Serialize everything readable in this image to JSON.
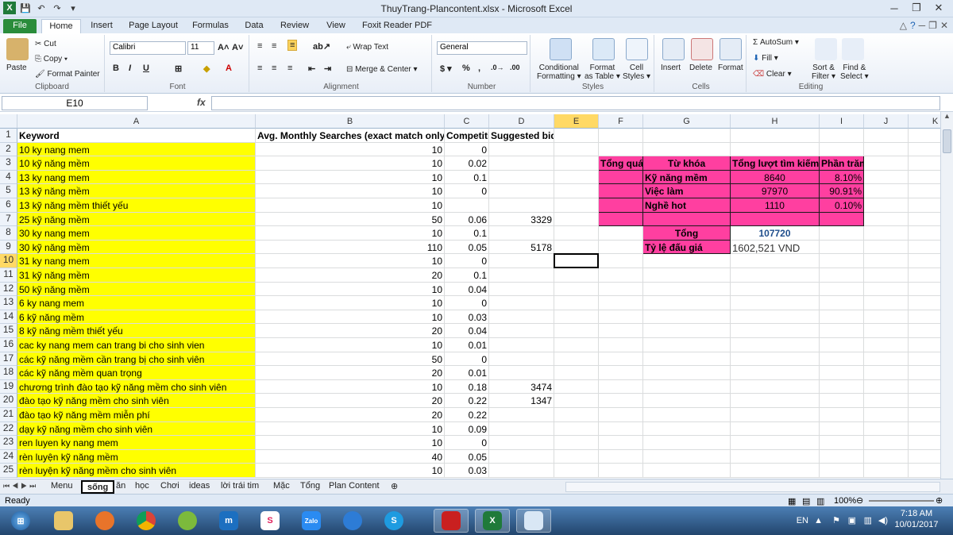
{
  "window": {
    "title": "ThuyTrang-Plancontent.xlsx - Microsoft Excel"
  },
  "ribbon": {
    "tabs": [
      "File",
      "Home",
      "Insert",
      "Page Layout",
      "Formulas",
      "Data",
      "Review",
      "View",
      "Foxit Reader PDF"
    ],
    "clipboard": {
      "paste": "Paste",
      "cut": "Cut",
      "copy": "Copy",
      "format_painter": "Format Painter",
      "label": "Clipboard"
    },
    "font": {
      "name": "Calibri",
      "size": "11",
      "label": "Font"
    },
    "alignment": {
      "wrap": "Wrap Text",
      "merge": "Merge & Center",
      "label": "Alignment"
    },
    "number": {
      "format": "General",
      "label": "Number"
    },
    "styles": {
      "conditional": "Conditional\nFormatting",
      "format_table": "Format\nas Table",
      "cell_styles": "Cell\nStyles",
      "label": "Styles"
    },
    "cells": {
      "insert": "Insert",
      "delete": "Delete",
      "format": "Format",
      "label": "Cells"
    },
    "editing": {
      "autosum": "AutoSum",
      "fill": "Fill",
      "clear": "Clear",
      "sort": "Sort &\nFilter",
      "find": "Find &\nSelect",
      "label": "Editing"
    }
  },
  "formula_bar": {
    "name_box": "E10",
    "fx": "fx",
    "content": ""
  },
  "columns": [
    "A",
    "B",
    "C",
    "D",
    "E",
    "F",
    "G",
    "H",
    "I",
    "J",
    "K"
  ],
  "selected_cell": "E10",
  "rows": [
    {
      "n": "1",
      "a": "Keyword",
      "b": "Avg. Monthly Searches (exact match only)",
      "c": "Competiti",
      "d": "Suggested bid"
    },
    {
      "n": "2",
      "a": "10 ky nang mem",
      "b": "10",
      "c": "0",
      "d": ""
    },
    {
      "n": "3",
      "a": "10 kỹ năng mềm",
      "b": "10",
      "c": "0.02",
      "d": ""
    },
    {
      "n": "4",
      "a": "13 ky nang mem",
      "b": "10",
      "c": "0.1",
      "d": ""
    },
    {
      "n": "5",
      "a": "13 kỹ năng mềm",
      "b": "10",
      "c": "0",
      "d": ""
    },
    {
      "n": "6",
      "a": "13 kỹ năng mềm thiết yếu",
      "b": "10",
      "c": "",
      "d": ""
    },
    {
      "n": "7",
      "a": "25 kỹ năng mềm",
      "b": "50",
      "c": "0.06",
      "d": "3329"
    },
    {
      "n": "8",
      "a": "30 ky nang mem",
      "b": "10",
      "c": "0.1",
      "d": ""
    },
    {
      "n": "9",
      "a": "30 kỹ năng mềm",
      "b": "110",
      "c": "0.05",
      "d": "5178"
    },
    {
      "n": "10",
      "a": "31 ky nang mem",
      "b": "10",
      "c": "0",
      "d": ""
    },
    {
      "n": "11",
      "a": "31 kỹ năng mềm",
      "b": "20",
      "c": "0.1",
      "d": ""
    },
    {
      "n": "12",
      "a": "50 kỹ năng mềm",
      "b": "10",
      "c": "0.04",
      "d": ""
    },
    {
      "n": "13",
      "a": "6 ky nang mem",
      "b": "10",
      "c": "0",
      "d": ""
    },
    {
      "n": "14",
      "a": "6 kỹ năng mềm",
      "b": "10",
      "c": "0.03",
      "d": ""
    },
    {
      "n": "15",
      "a": "8 kỹ năng mềm thiết yếu",
      "b": "20",
      "c": "0.04",
      "d": ""
    },
    {
      "n": "16",
      "a": "cac ky nang mem can trang bi cho sinh vien",
      "b": "10",
      "c": "0.01",
      "d": ""
    },
    {
      "n": "17",
      "a": "các kỹ năng mềm cần trang bị cho sinh viên",
      "b": "50",
      "c": "0",
      "d": ""
    },
    {
      "n": "18",
      "a": "các kỹ năng mềm quan trọng",
      "b": "20",
      "c": "0.01",
      "d": ""
    },
    {
      "n": "19",
      "a": "chương trình đào tạo kỹ năng mềm cho sinh viên",
      "b": "10",
      "c": "0.18",
      "d": "3474"
    },
    {
      "n": "20",
      "a": "đào tạo kỹ năng mềm cho sinh viên",
      "b": "20",
      "c": "0.22",
      "d": "1347"
    },
    {
      "n": "21",
      "a": "đào tạo kỹ năng mềm miễn phí",
      "b": "20",
      "c": "0.22",
      "d": ""
    },
    {
      "n": "22",
      "a": "dạy kỹ năng mềm cho sinh viên",
      "b": "10",
      "c": "0.09",
      "d": ""
    },
    {
      "n": "23",
      "a": "ren luyen ky nang mem",
      "b": "10",
      "c": "0",
      "d": ""
    },
    {
      "n": "24",
      "a": "rèn luyện kỹ năng mềm",
      "b": "40",
      "c": "0.05",
      "d": ""
    },
    {
      "n": "25",
      "a": "rèn luyện kỹ năng mềm cho sinh viên",
      "b": "10",
      "c": "0.03",
      "d": ""
    }
  ],
  "summary": {
    "f3": "Tổng quát",
    "g3": "Từ khóa",
    "h3": "Tổng lượt tìm kiếm",
    "i3": "Phần trăm",
    "items": [
      {
        "kw": "Kỹ năng mềm",
        "total": "8640",
        "pct": "8.10%"
      },
      {
        "kw": "Việc làm",
        "total": "97970",
        "pct": "90.91%"
      },
      {
        "kw": "Nghề hot",
        "total": "1110",
        "pct": "0.10%"
      }
    ],
    "total_label": "Tổng",
    "total_value": "107720",
    "bid_label": "Tỷ lệ đấu giá",
    "bid_value": "1602,521 VND"
  },
  "sheet_tabs": [
    "Menu",
    "sống",
    "ăn",
    "học",
    "Chơi",
    "ideas",
    "lời trái tim",
    "Mặc",
    "Tổng",
    "Plan Content"
  ],
  "active_sheet": "sống",
  "status": {
    "ready": "Ready",
    "zoom": "100%"
  },
  "taskbar": {
    "lang": "EN",
    "time": "7:18 AM",
    "date": "10/01/2017"
  }
}
